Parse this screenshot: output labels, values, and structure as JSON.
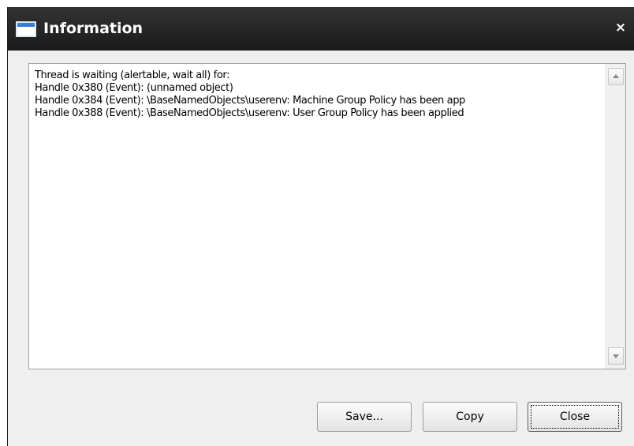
{
  "window": {
    "title": "Information",
    "close_glyph": "×"
  },
  "content": {
    "lines": [
      "Thread is waiting (alertable, wait all) for:",
      "Handle 0x380 (Event): (unnamed object)",
      "Handle 0x384 (Event): \\BaseNamedObjects\\userenv: Machine Group Policy has been app",
      "Handle 0x388 (Event): \\BaseNamedObjects\\userenv: User Group Policy has been applied"
    ]
  },
  "buttons": {
    "save_label": "Save...",
    "copy_label": "Copy",
    "close_label": "Close"
  },
  "icons": {
    "window_icon": "window-icon",
    "close_icon": "close-icon",
    "scroll_up": "scroll-up-arrow-icon",
    "scroll_down": "scroll-down-arrow-icon"
  },
  "colors": {
    "titlebar": "#222222",
    "window_bg": "#efefef",
    "text": "#000000"
  }
}
